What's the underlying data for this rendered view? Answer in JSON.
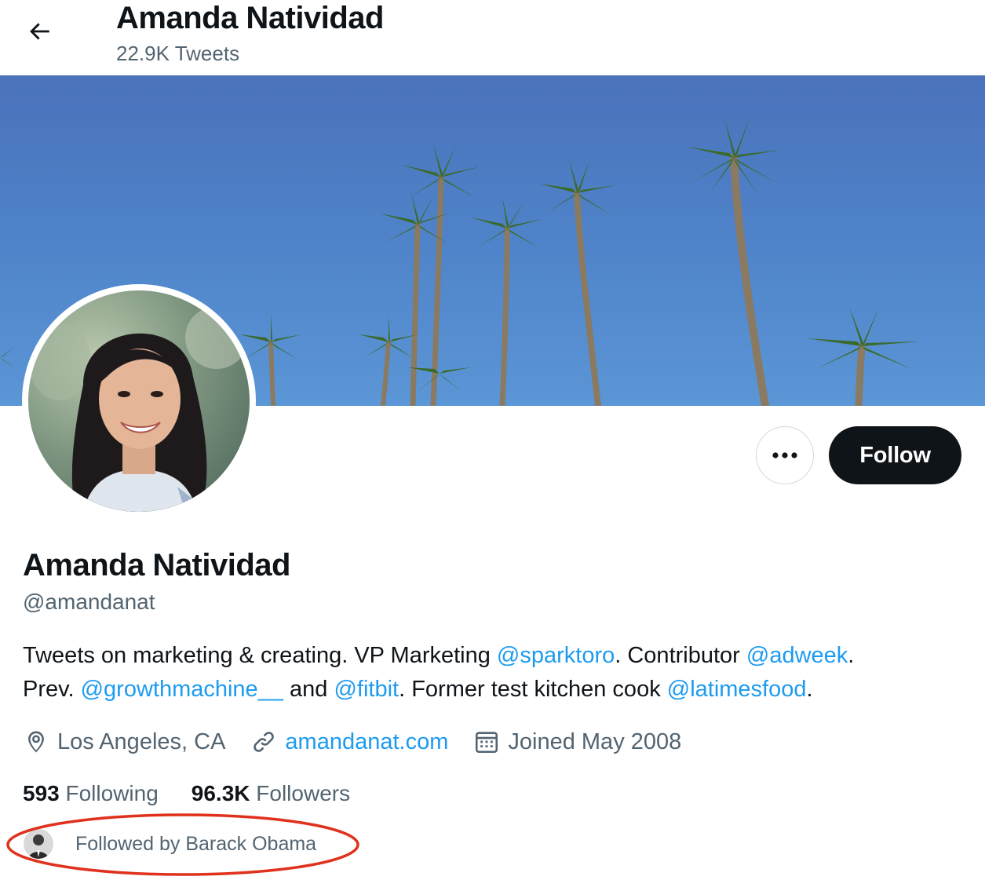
{
  "header": {
    "title": "Amanda Natividad",
    "tweet_count": "22.9K Tweets"
  },
  "profile": {
    "name": "Amanda Natividad",
    "handle": "@amandanat",
    "bio": {
      "line1_a": "Tweets on marketing & creating. VP Marketing ",
      "mention1": "@sparktoro",
      "line1_b": ". Contributor ",
      "mention2": "@adweek",
      "line1_c": ".",
      "line2_a": "Prev. ",
      "mention3": "@growthmachine__",
      "line2_b": " and ",
      "mention4": "@fitbit",
      "line2_c": ". Former test kitchen cook ",
      "mention5": "@latimesfood",
      "line2_d": "."
    },
    "location": "Los Angeles, CA",
    "website": "amandanat.com",
    "joined": "Joined May 2008",
    "following_count": "593",
    "following_label": "Following",
    "followers_count": "96.3K",
    "followers_label": "Followers",
    "followed_by": "Followed by Barack Obama"
  },
  "actions": {
    "follow_label": "Follow",
    "more_icon": "more-horizontal-icon"
  },
  "colors": {
    "accent": "#1d9bf0",
    "text_primary": "#0f1419",
    "text_secondary": "#536471",
    "follow_button_bg": "#0f1419",
    "highlight_ellipse": "#e0311d",
    "banner_sky": "#4f82c8"
  }
}
